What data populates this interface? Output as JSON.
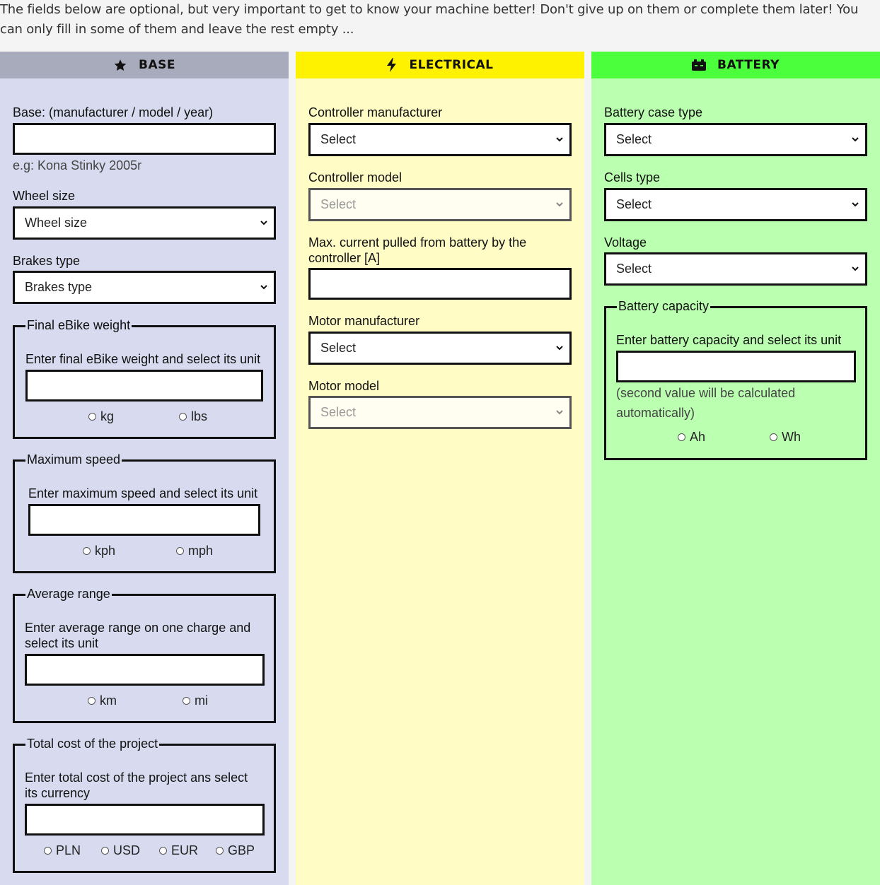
{
  "intro": "The fields below are optional, but very important to get to know your machine better! Don't give up on them or complete them later! You can only fill in some of them and leave the rest empty ...",
  "columns": {
    "base": {
      "title": "BASE",
      "icon": "star-icon",
      "color": "#d8dbef",
      "header_color": "#a8abbb",
      "base_label": "Base: (manufacturer / model / year)",
      "base_hint": "e.g: Kona Stinky 2005r",
      "wheel_label": "Wheel size",
      "wheel_value": "Wheel size",
      "brakes_label": "Brakes type",
      "brakes_value": "Brakes type",
      "weight": {
        "legend": "Final eBike weight",
        "prompt": "Enter final eBike weight and select its unit",
        "units": [
          "kg",
          "lbs"
        ]
      },
      "speed": {
        "legend": "Maximum speed",
        "prompt": "Enter maximum speed and select its unit",
        "units": [
          "kph",
          "mph"
        ]
      },
      "range": {
        "legend": "Average range",
        "prompt": "Enter average range on one charge and select its unit",
        "units": [
          "km",
          "mi"
        ]
      },
      "cost": {
        "legend": "Total cost of the project",
        "prompt": "Enter total cost of the project ans select its currency",
        "units": [
          "PLN",
          "USD",
          "EUR",
          "GBP"
        ]
      }
    },
    "electrical": {
      "title": "ELECTRICAL",
      "icon": "lightning-icon",
      "color": "#fffcc5",
      "header_color": "#fff200",
      "controller_manufacturer_label": "Controller manufacturer",
      "controller_manufacturer_value": "Select",
      "controller_model_label": "Controller model",
      "controller_model_value": "Select",
      "max_current_label": "Max. current pulled from battery by the controller [A]",
      "motor_manufacturer_label": "Motor manufacturer",
      "motor_manufacturer_value": "Select",
      "motor_model_label": "Motor model",
      "motor_model_value": "Select"
    },
    "battery": {
      "title": "BATTERY",
      "icon": "battery-icon",
      "color": "#bbffb0",
      "header_color": "#4cff3c",
      "case_label": "Battery case type",
      "case_value": "Select",
      "cells_label": "Cells type",
      "cells_value": "Select",
      "voltage_label": "Voltage",
      "voltage_value": "Select",
      "capacity": {
        "legend": "Battery capacity",
        "prompt": "Enter battery capacity and select its unit",
        "hint": "(second value will be calculated automatically)",
        "units": [
          "Ah",
          "Wh"
        ]
      }
    }
  }
}
